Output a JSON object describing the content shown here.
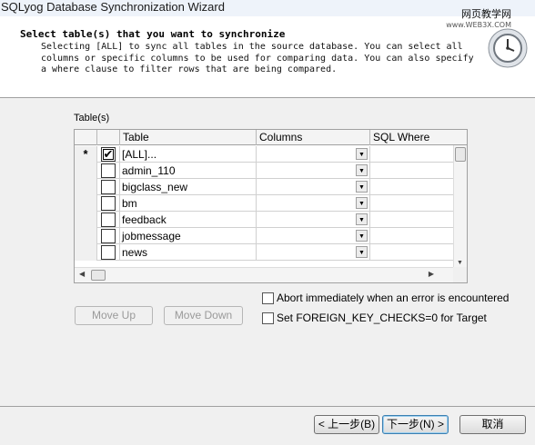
{
  "window": {
    "title": "SQLyog Database Synchronization Wizard"
  },
  "header": {
    "title": "Select table(s) that you want to synchronize",
    "description": "Selecting [ALL] to sync all tables in the source database. You can select all columns or specific columns to be used for comparing data. You can also specify a where clause to filter rows that are being compared.",
    "watermark_text": "网页教学网",
    "watermark_url": "www.WEB3X.COM",
    "icon": "clock-icon"
  },
  "tables_group": {
    "label": "Table(s)"
  },
  "grid": {
    "columns": [
      "Table",
      "Columns",
      "SQL Where"
    ],
    "rows": [
      {
        "indicator": "*",
        "checked": true,
        "table": "[ALL]..."
      },
      {
        "indicator": "",
        "checked": false,
        "table": "admin_110"
      },
      {
        "indicator": "",
        "checked": false,
        "table": "bigclass_new"
      },
      {
        "indicator": "",
        "checked": false,
        "table": "bm"
      },
      {
        "indicator": "",
        "checked": false,
        "table": "feedback"
      },
      {
        "indicator": "",
        "checked": false,
        "table": "jobmessage"
      },
      {
        "indicator": "",
        "checked": false,
        "table": "news"
      }
    ]
  },
  "buttons": {
    "move_up": "Move Up",
    "move_down": "Move Down",
    "back": "< 上一步(B)",
    "next": "下一步(N) >",
    "cancel": "取消"
  },
  "options": {
    "abort_on_error": {
      "label": "Abort immediately when an error is encountered",
      "checked": false
    },
    "fk_checks": {
      "label": "Set FOREIGN_KEY_CHECKS=0 for Target",
      "checked": false
    }
  }
}
